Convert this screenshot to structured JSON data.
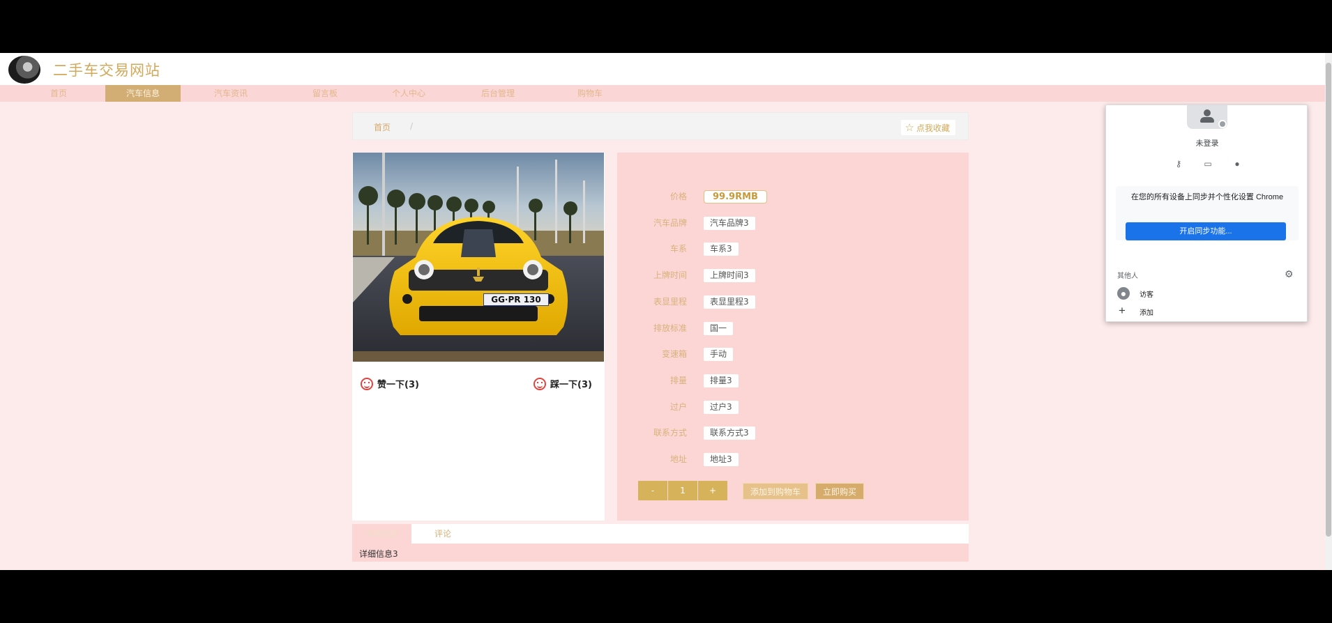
{
  "site": {
    "title": "二手车交易网站"
  },
  "nav": {
    "items": [
      {
        "label": "首页"
      },
      {
        "label": "汽车信息"
      },
      {
        "label": "汽车资讯"
      },
      {
        "label": "留言板"
      },
      {
        "label": "个人中心"
      },
      {
        "label": "后台管理"
      },
      {
        "label": "购物车"
      }
    ],
    "active_index": 1
  },
  "breadcrumb": {
    "home": "首页",
    "separator": "/"
  },
  "favorite": {
    "label": "点我收藏"
  },
  "votes": {
    "up_label": "赞一下(3)",
    "down_label": "踩一下(3)"
  },
  "details": {
    "rows": [
      {
        "label": "价格",
        "value": "99.9RMB"
      },
      {
        "label": "汽车品牌",
        "value": "汽车品牌3"
      },
      {
        "label": "车系",
        "value": "车系3"
      },
      {
        "label": "上牌时间",
        "value": "上牌时间3"
      },
      {
        "label": "表显里程",
        "value": "表显里程3"
      },
      {
        "label": "排放标准",
        "value": "国一"
      },
      {
        "label": "变速箱",
        "value": "手动"
      },
      {
        "label": "排量",
        "value": "排量3"
      },
      {
        "label": "过户",
        "value": "过户3"
      },
      {
        "label": "联系方式",
        "value": "联系方式3"
      },
      {
        "label": "地址",
        "value": "地址3"
      }
    ]
  },
  "quantity": {
    "minus": "-",
    "value": "1",
    "plus": "+"
  },
  "actions": {
    "add_to_cart": "添加到购物车",
    "buy_now": "立即购买"
  },
  "tabs": [
    {
      "label": "详细信息"
    },
    {
      "label": "评论"
    }
  ],
  "detail_body": {
    "text": "详细信息3"
  },
  "car_photo": {
    "plate": "GG·PR 130"
  },
  "chrome_profile": {
    "status": "未登录",
    "sync_text": "在您的所有设备上同步并个性化设置 Chrome",
    "sync_button": "开启同步功能...",
    "others_label": "其他人",
    "guest": "访客",
    "add": "添加"
  }
}
